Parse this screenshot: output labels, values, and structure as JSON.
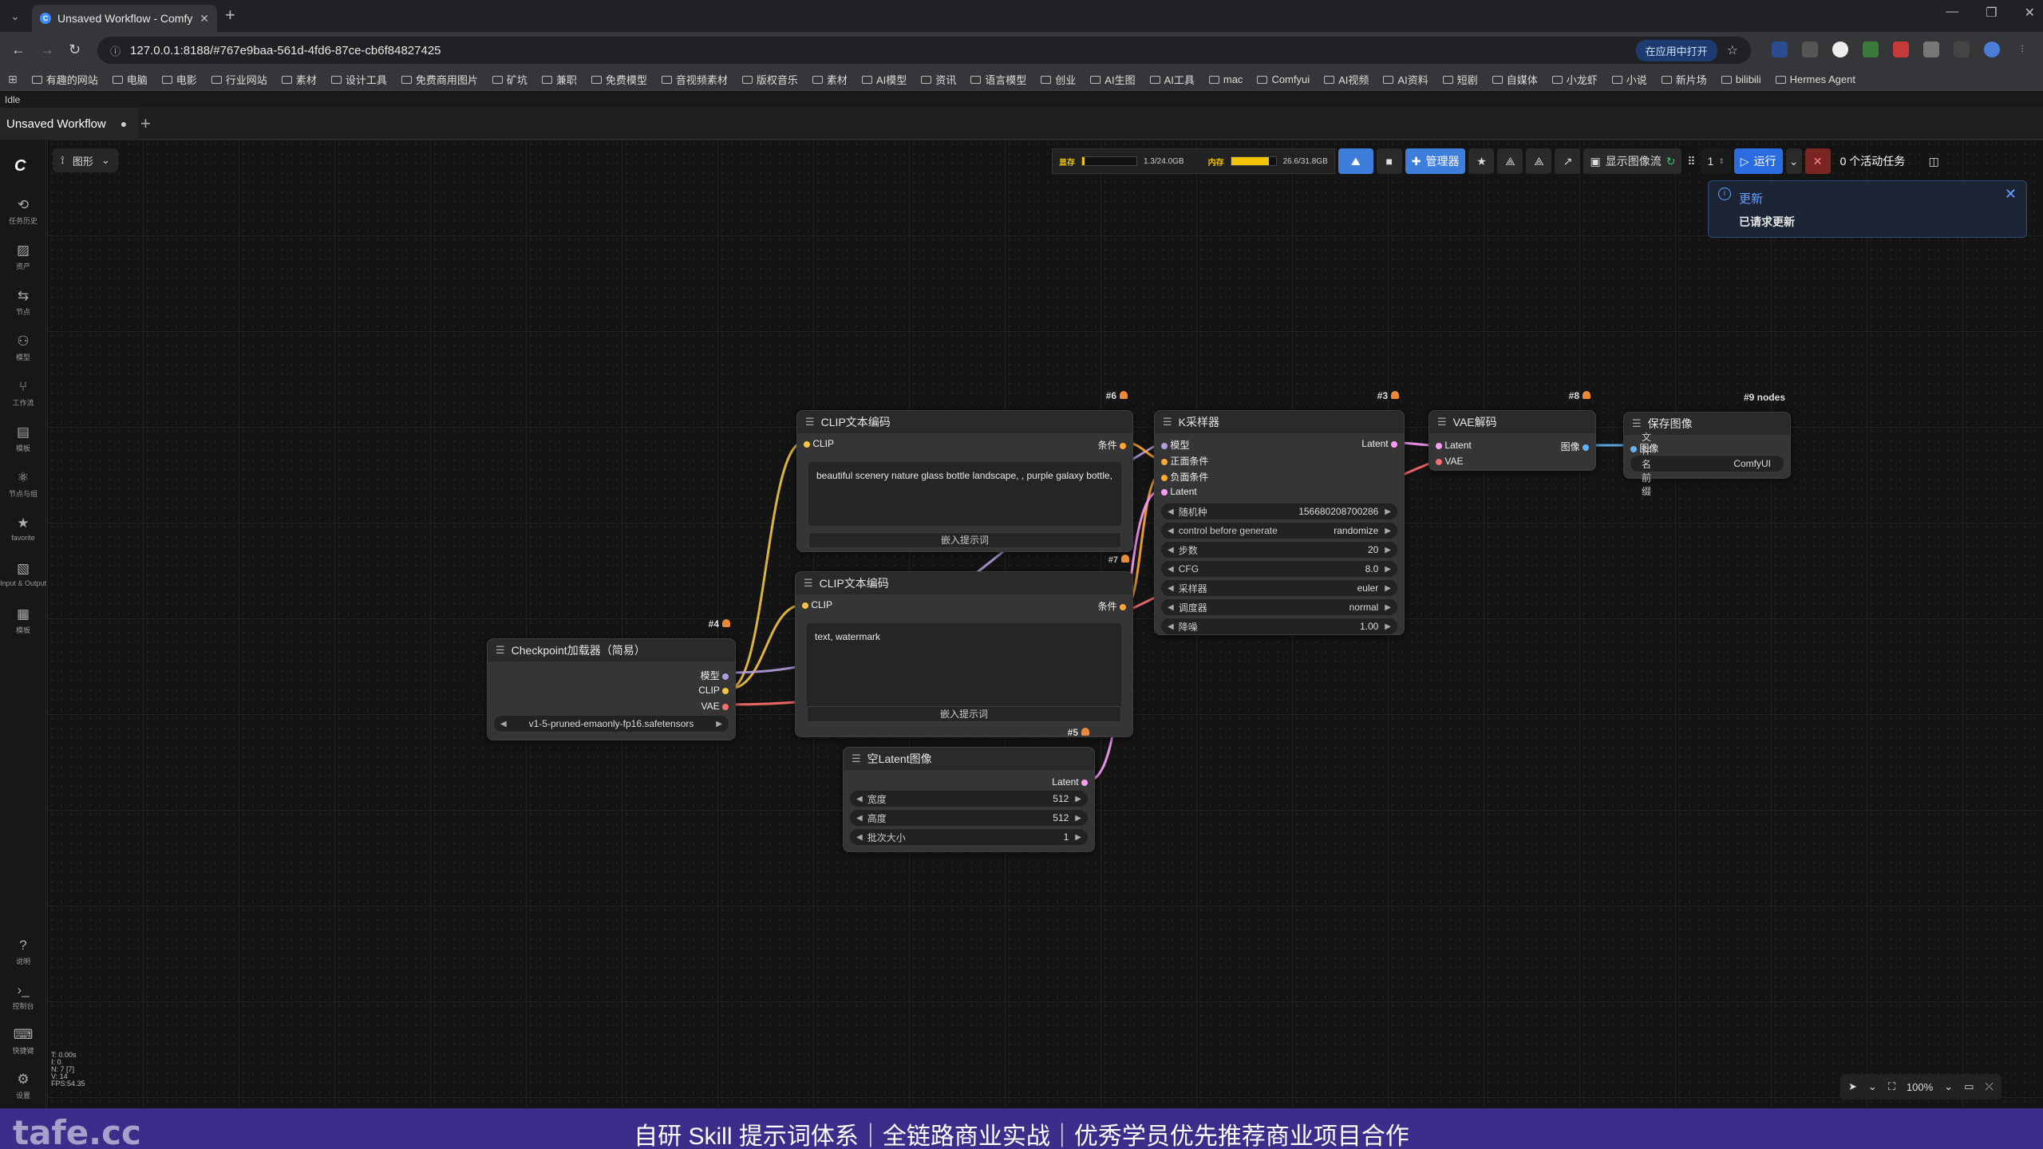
{
  "browser": {
    "tab_title": "Unsaved Workflow - ComfyUI",
    "url": "127.0.0.1:8188/#767e9baa-561d-4fd6-87ce-cb6f84827425",
    "open_in_app": "在应用中打开",
    "bookmarks": [
      "有趣的网站",
      "电脑",
      "电影",
      "行业网站",
      "素材",
      "设计工具",
      "免费商用图片",
      "矿坑",
      "兼职",
      "免费模型",
      "音视频素材",
      "版权音乐",
      "素材",
      "AI模型",
      "资讯",
      "语言模型",
      "创业",
      "AI生图",
      "AI工具",
      "mac",
      "Comfyui",
      "AI视频",
      "AI资料",
      "短剧",
      "自媒体",
      "小龙虾",
      "小说",
      "新片场",
      "bilibili",
      "Hermes Agent"
    ]
  },
  "app": {
    "status": "Idle",
    "workflow_tab": "Unsaved Workflow",
    "graph_button": "图形",
    "sidebar": [
      {
        "icon": "history-icon",
        "label": "任务历史"
      },
      {
        "icon": "assets-icon",
        "label": "资产"
      },
      {
        "icon": "nodes-icon",
        "label": "节点"
      },
      {
        "icon": "models-icon",
        "label": "模型"
      },
      {
        "icon": "workflows-icon",
        "label": "工作流"
      },
      {
        "icon": "templates-icon",
        "label": "模板"
      },
      {
        "icon": "node-library-icon",
        "label": "节点与组"
      },
      {
        "icon": "star-icon",
        "label": "favorite"
      },
      {
        "icon": "io-icon",
        "label": "Input & Output"
      },
      {
        "icon": "model-list-icon",
        "label": "模板"
      }
    ],
    "sidebar_bottom": [
      {
        "icon": "help-icon",
        "label": "说明"
      },
      {
        "icon": "terminal-icon",
        "label": "控制台"
      },
      {
        "icon": "keyboard-icon",
        "label": "快捷键"
      },
      {
        "icon": "settings-icon",
        "label": "设置"
      }
    ]
  },
  "topmenu": {
    "vram_label": "显存",
    "vram_value": "1.3/24.0GB",
    "vram_fraction": 0.05,
    "ram_label": "内存",
    "ram_value": "26.6/31.8GB",
    "ram_fraction": 0.84,
    "manager_label": "管理器",
    "show_image_flow": "显示图像流",
    "batch_count": "1",
    "run_label": "运行",
    "active_tasks": "0 个活动任务"
  },
  "toast": {
    "title": "更新",
    "message": "已请求更新"
  },
  "nodes": {
    "clip_pos": {
      "id": "#6",
      "title": "CLIP文本编码",
      "input": "CLIP",
      "output": "条件",
      "text": "beautiful scenery nature glass bottle landscape, , purple galaxy bottle,",
      "embed": "嵌入提示词"
    },
    "clip_neg": {
      "id": "#7",
      "title": "CLIP文本编码",
      "input": "CLIP",
      "output": "条件",
      "text": "text, watermark",
      "embed": "嵌入提示词"
    },
    "ksampler": {
      "id": "#3",
      "title": "K采样器",
      "inputs": [
        "模型",
        "正面条件",
        "负面条件",
        "Latent"
      ],
      "output": "Latent",
      "widgets": [
        {
          "name": "随机种",
          "value": "156680208700286"
        },
        {
          "name": "control before generate",
          "value": "randomize"
        },
        {
          "name": "步数",
          "value": "20"
        },
        {
          "name": "CFG",
          "value": "8.0"
        },
        {
          "name": "采样器",
          "value": "euler"
        },
        {
          "name": "调度器",
          "value": "normal"
        },
        {
          "name": "降噪",
          "value": "1.00"
        }
      ]
    },
    "vae_decode": {
      "id": "#8",
      "title": "VAE解码",
      "inputs": [
        "Latent",
        "VAE"
      ],
      "output": "图像"
    },
    "save_image": {
      "id": "#9 nodes",
      "title": "保存图像",
      "input": "图像",
      "prefix_label": "文件名前缀",
      "prefix_value": "ComfyUI"
    },
    "checkpoint": {
      "id": "#4",
      "title": "Checkpoint加载器（简易）",
      "outputs": [
        "模型",
        "CLIP",
        "VAE"
      ],
      "ckpt": "v1-5-pruned-emaonly-fp16.safetensors"
    },
    "empty_latent": {
      "id": "#5",
      "title": "空Latent图像",
      "output": "Latent",
      "widgets": [
        {
          "name": "宽度",
          "value": "512"
        },
        {
          "name": "高度",
          "value": "512"
        },
        {
          "name": "批次大小",
          "value": "1"
        }
      ]
    }
  },
  "canvas_ctrls": {
    "zoom": "100%"
  },
  "stats": [
    "T: 0.00s",
    "I: 0",
    "N: 7 [7]",
    "V: 14",
    "FPS:54.35"
  ],
  "banner": {
    "watermark": "tafe.cc",
    "text": "自研 Skill 提示词体系｜全链路商业实战｜优秀学员优先推荐商业项目合作"
  },
  "colors": {
    "clip": "#f5c542",
    "model": "#b39ddb",
    "conditioning": "#ffa931",
    "latent": "#ff9cf9",
    "vae": "#ff6e6e",
    "image": "#64b5f6",
    "accent": "#2b6de0"
  }
}
